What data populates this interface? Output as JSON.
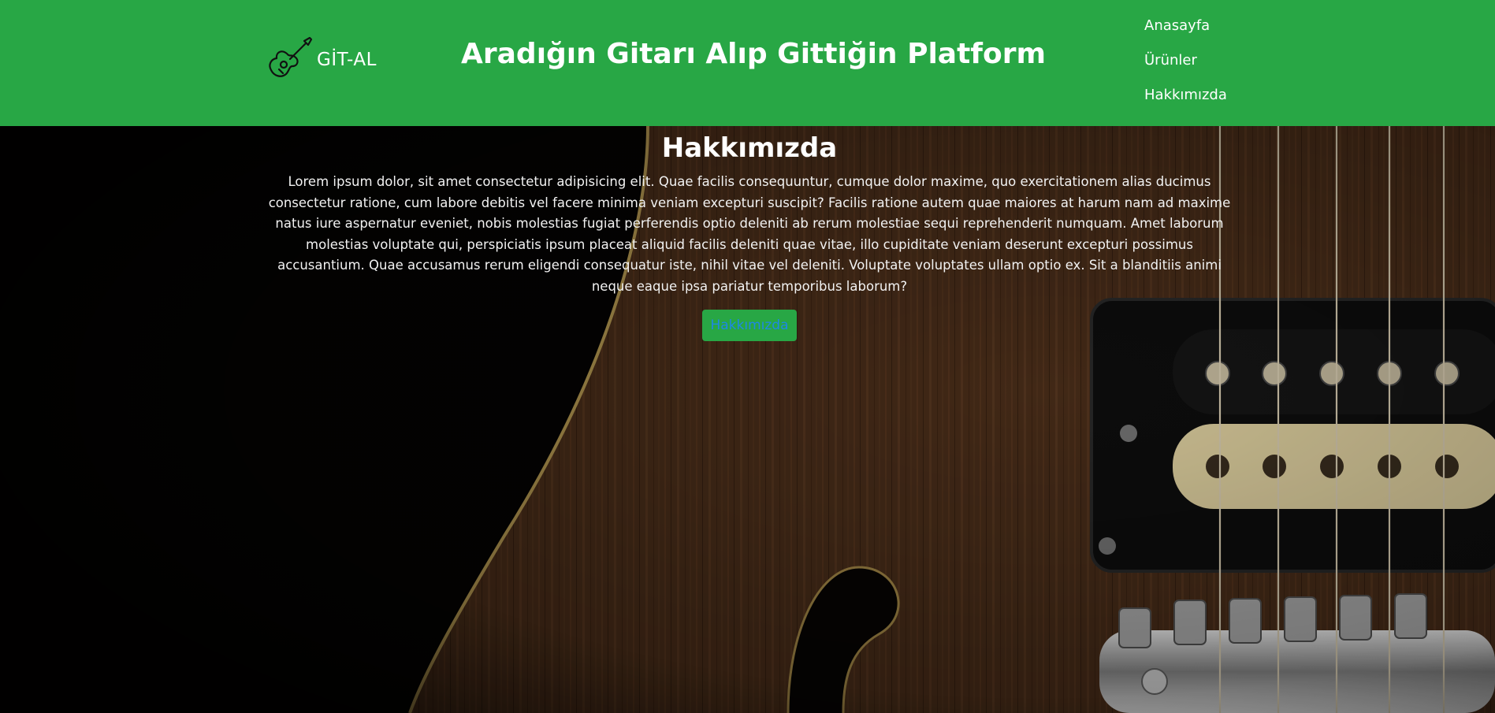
{
  "header": {
    "logo_text": "GİT-AL",
    "title": "Aradığın Gitarı Alıp Gittiğin Platform",
    "nav": [
      "Anasayfa",
      "Ürünler",
      "Hakkımızda"
    ]
  },
  "about": {
    "heading": "Hakkımızda",
    "text": "Lorem ipsum dolor, sit amet consectetur adipisicing elit. Quae facilis consequuntur, cumque dolor maxime, quo exercitationem alias ducimus consectetur ratione, cum labore debitis vel facere minima veniam excepturi suscipit? Facilis ratione autem quae maiores at harum nam ad maxime natus iure aspernatur eveniet, nobis molestias fugiat perferendis optio deleniti ab rerum molestiae sequi reprehenderit numquam. Amet laborum molestias voluptate qui, perspiciatis ipsum placeat aliquid facilis deleniti quae vitae, illo cupiditate veniam deserunt excepturi possimus accusantium. Quae accusamus rerum eligendi consequatur iste, nihil vitae vel deleniti. Voluptate voluptates ullam optio ex. Sit a blanditiis animi neque eaque ipsa pariatur temporibus laborum?",
    "button_label": "Hakkımızda"
  },
  "colors": {
    "header_bg": "#28a745",
    "button_bg": "#28a745",
    "button_text": "#1e88e5"
  },
  "icons": [
    "guitar-icon"
  ]
}
